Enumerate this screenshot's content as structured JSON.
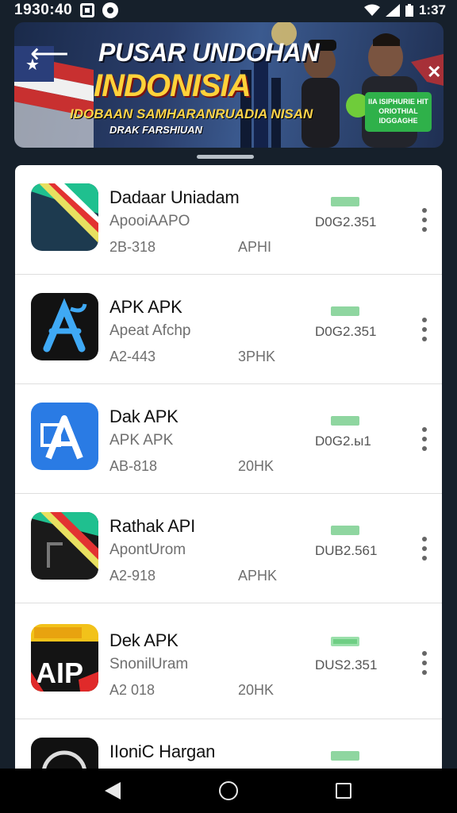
{
  "status_bar": {
    "time": "1930:40",
    "clock": "1:37"
  },
  "banner": {
    "title_line1": "PUSAR UNDOHAN",
    "title_line2": "INDONISIA",
    "subtitle": "IDOBAAN SAMHARANRUADIA NISAN",
    "tagline": "DRAK FARSHIUAN",
    "green_box_text": "IIA ISIPHURIE HIT ORIOTHIAL IDGGAGHE"
  },
  "apps": [
    {
      "name": "Dadaar Uniadam",
      "subtitle": "ApooiAAPO",
      "meta1": "2B-318",
      "meta2": "APHI",
      "size": "D0G2.351",
      "icon": "striped-flag-icon"
    },
    {
      "name": "APK APK",
      "subtitle": "Apeat Afchp",
      "meta1": "A2-443",
      "meta2": "3PHK",
      "size": "D0G2.351",
      "icon": "blue-a-logo-icon"
    },
    {
      "name": "Dak APK",
      "subtitle": "APK APK",
      "meta1": "AB-818",
      "meta2": "20HK",
      "size": "D0G2.ы1",
      "icon": "blue-a-logo-icon"
    },
    {
      "name": "Rathak API",
      "subtitle": "ApontUrom",
      "meta1": "A2-918",
      "meta2": "APHK",
      "size": "DUB2.561",
      "icon": "striped-flag-icon"
    },
    {
      "name": "Dek APK",
      "subtitle": "SnonilUram",
      "meta1": "A2 018",
      "meta2": "20HK",
      "size": "DUS2.351",
      "icon": "aip-poster-icon"
    },
    {
      "name": "IIoniC Hargan",
      "subtitle": "",
      "meta1": "",
      "meta2": "",
      "size": "",
      "icon": "dark-ring-icon"
    }
  ],
  "colors": {
    "background": "#16202b",
    "download_bar": "#8fd6a0",
    "banner_title_yellow": "#ffd23a",
    "banner_green": "#2fb14a"
  }
}
